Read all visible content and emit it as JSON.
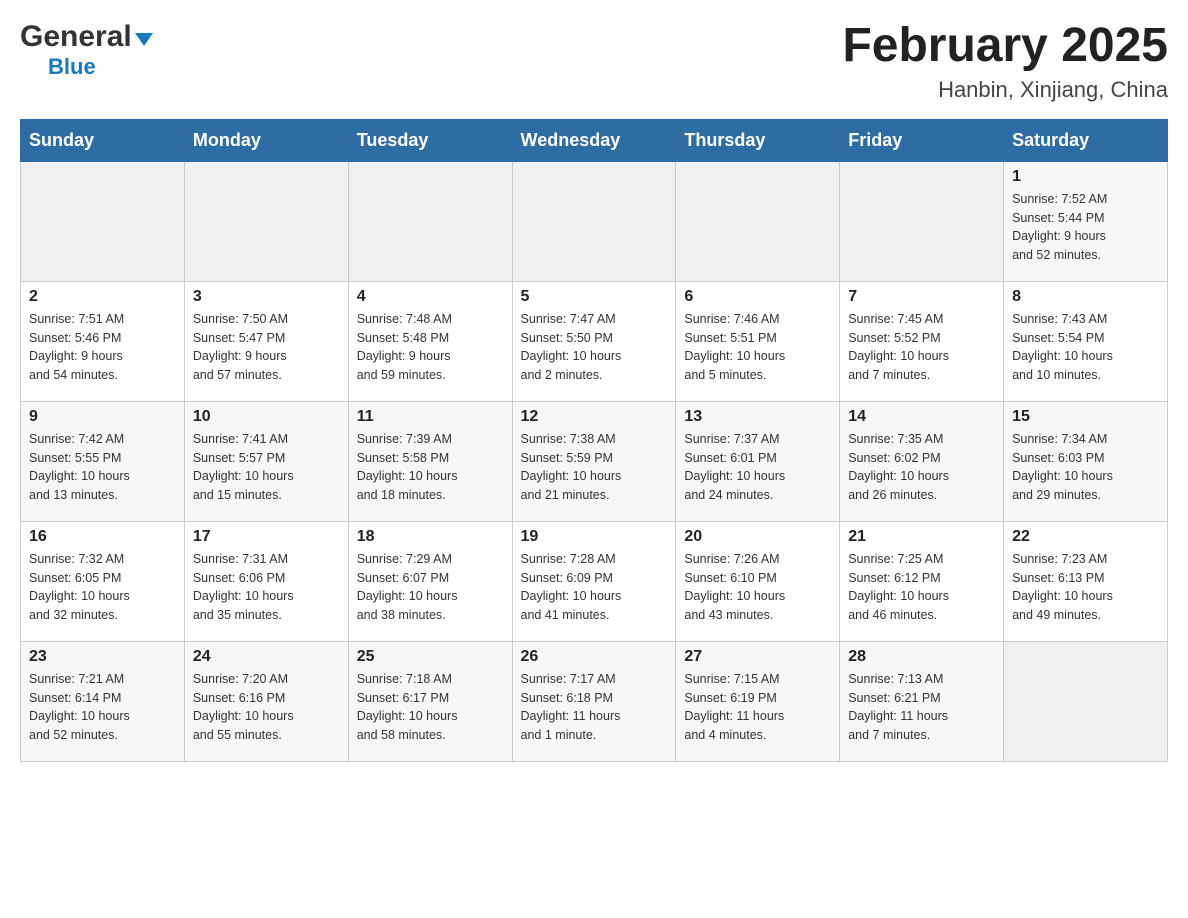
{
  "header": {
    "logo_general": "General",
    "logo_blue": "Blue",
    "month_title": "February 2025",
    "location": "Hanbin, Xinjiang, China"
  },
  "weekdays": [
    "Sunday",
    "Monday",
    "Tuesday",
    "Wednesday",
    "Thursday",
    "Friday",
    "Saturday"
  ],
  "weeks": [
    [
      {
        "day": "",
        "info": ""
      },
      {
        "day": "",
        "info": ""
      },
      {
        "day": "",
        "info": ""
      },
      {
        "day": "",
        "info": ""
      },
      {
        "day": "",
        "info": ""
      },
      {
        "day": "",
        "info": ""
      },
      {
        "day": "1",
        "info": "Sunrise: 7:52 AM\nSunset: 5:44 PM\nDaylight: 9 hours\nand 52 minutes."
      }
    ],
    [
      {
        "day": "2",
        "info": "Sunrise: 7:51 AM\nSunset: 5:46 PM\nDaylight: 9 hours\nand 54 minutes."
      },
      {
        "day": "3",
        "info": "Sunrise: 7:50 AM\nSunset: 5:47 PM\nDaylight: 9 hours\nand 57 minutes."
      },
      {
        "day": "4",
        "info": "Sunrise: 7:48 AM\nSunset: 5:48 PM\nDaylight: 9 hours\nand 59 minutes."
      },
      {
        "day": "5",
        "info": "Sunrise: 7:47 AM\nSunset: 5:50 PM\nDaylight: 10 hours\nand 2 minutes."
      },
      {
        "day": "6",
        "info": "Sunrise: 7:46 AM\nSunset: 5:51 PM\nDaylight: 10 hours\nand 5 minutes."
      },
      {
        "day": "7",
        "info": "Sunrise: 7:45 AM\nSunset: 5:52 PM\nDaylight: 10 hours\nand 7 minutes."
      },
      {
        "day": "8",
        "info": "Sunrise: 7:43 AM\nSunset: 5:54 PM\nDaylight: 10 hours\nand 10 minutes."
      }
    ],
    [
      {
        "day": "9",
        "info": "Sunrise: 7:42 AM\nSunset: 5:55 PM\nDaylight: 10 hours\nand 13 minutes."
      },
      {
        "day": "10",
        "info": "Sunrise: 7:41 AM\nSunset: 5:57 PM\nDaylight: 10 hours\nand 15 minutes."
      },
      {
        "day": "11",
        "info": "Sunrise: 7:39 AM\nSunset: 5:58 PM\nDaylight: 10 hours\nand 18 minutes."
      },
      {
        "day": "12",
        "info": "Sunrise: 7:38 AM\nSunset: 5:59 PM\nDaylight: 10 hours\nand 21 minutes."
      },
      {
        "day": "13",
        "info": "Sunrise: 7:37 AM\nSunset: 6:01 PM\nDaylight: 10 hours\nand 24 minutes."
      },
      {
        "day": "14",
        "info": "Sunrise: 7:35 AM\nSunset: 6:02 PM\nDaylight: 10 hours\nand 26 minutes."
      },
      {
        "day": "15",
        "info": "Sunrise: 7:34 AM\nSunset: 6:03 PM\nDaylight: 10 hours\nand 29 minutes."
      }
    ],
    [
      {
        "day": "16",
        "info": "Sunrise: 7:32 AM\nSunset: 6:05 PM\nDaylight: 10 hours\nand 32 minutes."
      },
      {
        "day": "17",
        "info": "Sunrise: 7:31 AM\nSunset: 6:06 PM\nDaylight: 10 hours\nand 35 minutes."
      },
      {
        "day": "18",
        "info": "Sunrise: 7:29 AM\nSunset: 6:07 PM\nDaylight: 10 hours\nand 38 minutes."
      },
      {
        "day": "19",
        "info": "Sunrise: 7:28 AM\nSunset: 6:09 PM\nDaylight: 10 hours\nand 41 minutes."
      },
      {
        "day": "20",
        "info": "Sunrise: 7:26 AM\nSunset: 6:10 PM\nDaylight: 10 hours\nand 43 minutes."
      },
      {
        "day": "21",
        "info": "Sunrise: 7:25 AM\nSunset: 6:12 PM\nDaylight: 10 hours\nand 46 minutes."
      },
      {
        "day": "22",
        "info": "Sunrise: 7:23 AM\nSunset: 6:13 PM\nDaylight: 10 hours\nand 49 minutes."
      }
    ],
    [
      {
        "day": "23",
        "info": "Sunrise: 7:21 AM\nSunset: 6:14 PM\nDaylight: 10 hours\nand 52 minutes."
      },
      {
        "day": "24",
        "info": "Sunrise: 7:20 AM\nSunset: 6:16 PM\nDaylight: 10 hours\nand 55 minutes."
      },
      {
        "day": "25",
        "info": "Sunrise: 7:18 AM\nSunset: 6:17 PM\nDaylight: 10 hours\nand 58 minutes."
      },
      {
        "day": "26",
        "info": "Sunrise: 7:17 AM\nSunset: 6:18 PM\nDaylight: 11 hours\nand 1 minute."
      },
      {
        "day": "27",
        "info": "Sunrise: 7:15 AM\nSunset: 6:19 PM\nDaylight: 11 hours\nand 4 minutes."
      },
      {
        "day": "28",
        "info": "Sunrise: 7:13 AM\nSunset: 6:21 PM\nDaylight: 11 hours\nand 7 minutes."
      },
      {
        "day": "",
        "info": ""
      }
    ]
  ]
}
